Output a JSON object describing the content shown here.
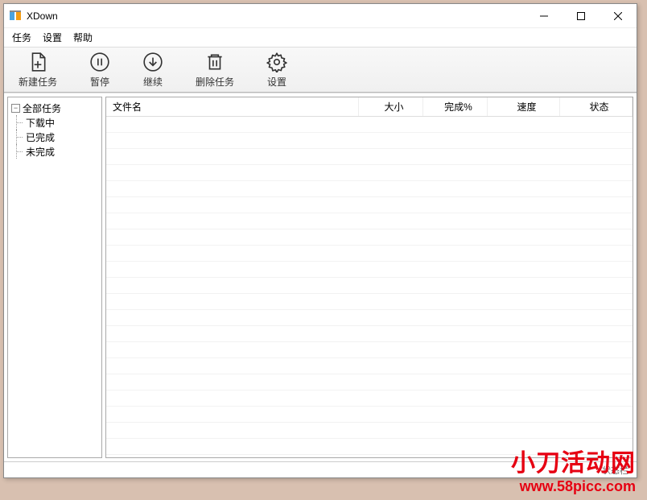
{
  "window": {
    "title": "XDown"
  },
  "menu": {
    "task": "任务",
    "settings": "设置",
    "help": "帮助"
  },
  "toolbar": {
    "new": "新建任务",
    "pause": "暂停",
    "resume": "继续",
    "delete": "删除任务",
    "settings": "设置"
  },
  "tree": {
    "root": "全部任务",
    "children": [
      "下载中",
      "已完成",
      "未完成"
    ]
  },
  "columns": {
    "filename": "文件名",
    "size": "大小",
    "done": "完成%",
    "speed": "速度",
    "status": "状态"
  },
  "status": {
    "text": "状态栏"
  },
  "watermark": {
    "line1": "小刀活动网",
    "line2": "www.58picc.com"
  }
}
